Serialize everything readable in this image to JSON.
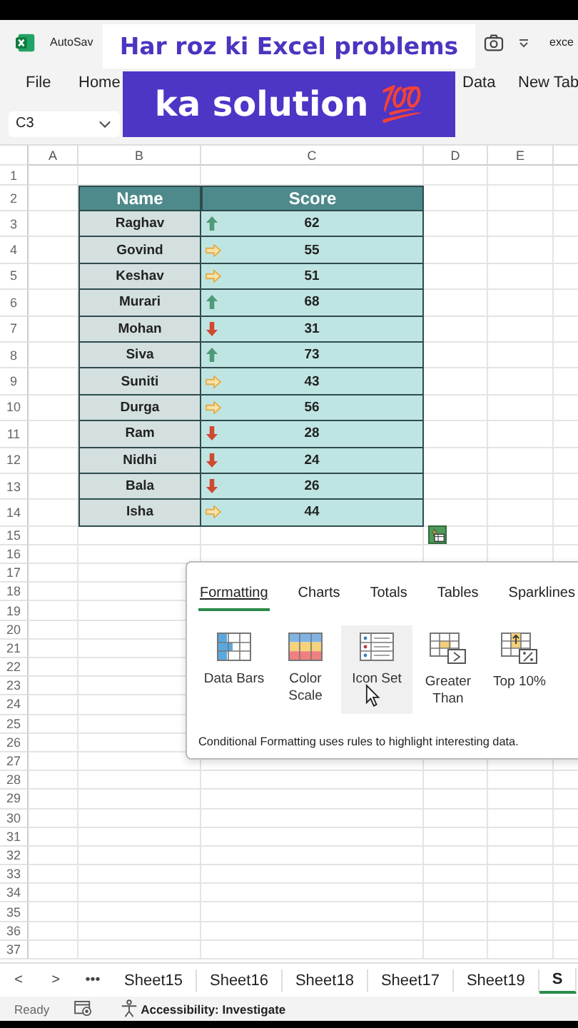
{
  "caption": {
    "line1": "Har roz ki Excel problems",
    "line2": "ka solution 💯"
  },
  "title_bar": {
    "autosave": "AutoSav",
    "file_name": "exce"
  },
  "ribbon_tabs": [
    {
      "label": "File"
    },
    {
      "label": "Home"
    },
    {
      "label": "Data"
    },
    {
      "label": "New Tab"
    }
  ],
  "name_box": "C3",
  "columns": [
    "A",
    "B",
    "C",
    "D",
    "E"
  ],
  "row_numbers": [
    "1",
    "2",
    "3",
    "4",
    "5",
    "6",
    "7",
    "8",
    "9",
    "10",
    "11",
    "12",
    "13",
    "14",
    "15",
    "16",
    "17",
    "18",
    "19",
    "20",
    "21",
    "22",
    "23",
    "24",
    "25",
    "26",
    "27",
    "28",
    "29",
    "30",
    "31",
    "32",
    "33",
    "34",
    "35",
    "36",
    "37"
  ],
  "table": {
    "columns": [
      "Name",
      "Score"
    ],
    "rows": [
      {
        "name": "Raghav",
        "kind": "up",
        "score": "62"
      },
      {
        "name": "Govind",
        "kind": "side",
        "score": "55"
      },
      {
        "name": "Keshav",
        "kind": "side",
        "score": "51"
      },
      {
        "name": "Murari",
        "kind": "up",
        "score": "68"
      },
      {
        "name": "Mohan",
        "kind": "down",
        "score": "31"
      },
      {
        "name": "Siva",
        "kind": "up",
        "score": "73"
      },
      {
        "name": "Suniti",
        "kind": "side",
        "score": "43"
      },
      {
        "name": "Durga",
        "kind": "side",
        "score": "56"
      },
      {
        "name": "Ram",
        "kind": "down",
        "score": "28"
      },
      {
        "name": "Nidhi",
        "kind": "down",
        "score": "24"
      },
      {
        "name": "Bala",
        "kind": "down",
        "score": "26"
      },
      {
        "name": "Isha",
        "kind": "side",
        "score": "44"
      }
    ]
  },
  "quick_analysis": {
    "tabs": [
      {
        "label": "Formatting",
        "selected": true
      },
      {
        "label": "Charts",
        "selected": false
      },
      {
        "label": "Totals",
        "selected": false
      },
      {
        "label": "Tables",
        "selected": false
      },
      {
        "label": "Sparklines",
        "selected": false
      }
    ],
    "options": [
      {
        "kind": "data-bars",
        "lines": [
          "Data Bars"
        ],
        "selected": false
      },
      {
        "kind": "color-scale",
        "lines": [
          "Color",
          "Scale"
        ],
        "selected": false
      },
      {
        "kind": "icon-set",
        "lines": [
          "Icon Set"
        ],
        "selected": true
      },
      {
        "kind": "greater-than",
        "lines": [
          "Greater",
          "Than"
        ],
        "selected": false
      },
      {
        "kind": "top-10",
        "lines": [
          "Top 10%"
        ],
        "selected": false
      }
    ],
    "description": "Conditional Formatting uses rules to highlight interesting data."
  },
  "sheet_nav": [
    "<",
    ">",
    "•••"
  ],
  "sheet_tabs": [
    {
      "label": "Sheet15",
      "selected": false
    },
    {
      "label": "Sheet16",
      "selected": false
    },
    {
      "label": "Sheet18",
      "selected": false
    },
    {
      "label": "Sheet17",
      "selected": false
    },
    {
      "label": "Sheet19",
      "selected": false
    },
    {
      "label": "S",
      "selected": true
    }
  ],
  "status_bar": {
    "ready": "Ready",
    "accessibility": "Accessibility: Investigate"
  }
}
